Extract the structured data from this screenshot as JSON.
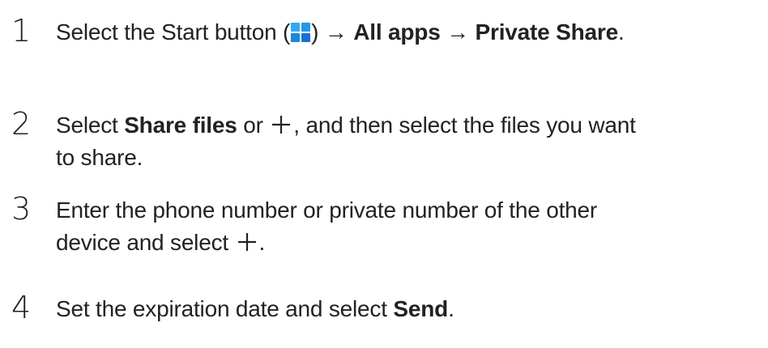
{
  "steps": [
    {
      "number": "1",
      "parts": {
        "a": "Select the Start button (",
        "b": ") → ",
        "c": "All apps",
        "d": " → ",
        "e": "Private Share",
        "f": "."
      },
      "icons": [
        "windows-start-icon"
      ]
    },
    {
      "number": "2",
      "parts": {
        "a": "Select ",
        "b": "Share files",
        "c": " or ",
        "d": ", and then select the files you want",
        "e": "to share."
      },
      "icons": [
        "plus-icon"
      ]
    },
    {
      "number": "3",
      "parts": {
        "a": "Enter the phone number or private number of the other",
        "b": "device and select ",
        "c": "."
      },
      "icons": [
        "plus-icon"
      ]
    },
    {
      "number": "4",
      "parts": {
        "a": "Set the expiration date and select ",
        "b": "Send",
        "c": "."
      }
    }
  ],
  "colors": {
    "windows_icon_blue": "#1a8fe3",
    "text": "#222222"
  }
}
